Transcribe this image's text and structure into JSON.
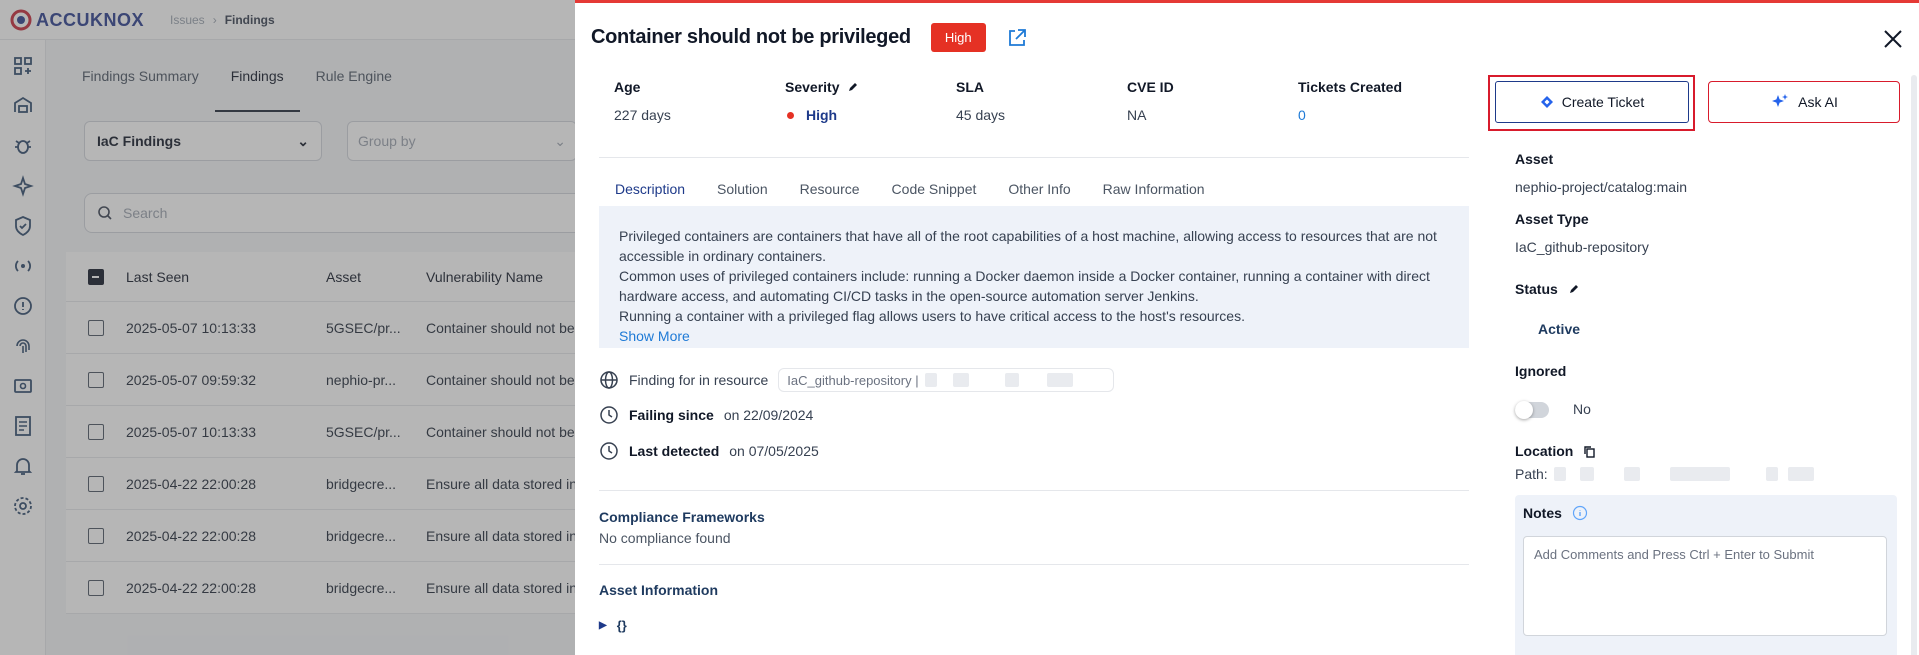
{
  "app": {
    "logo": "ACCUKNOX",
    "breadcrumb": [
      "Issues",
      "Findings"
    ]
  },
  "background": {
    "tabs": [
      "Findings Summary",
      "Findings",
      "Rule Engine"
    ],
    "active_tab": "Findings",
    "filter_select": "IaC Findings",
    "group_by_placeholder": "Group by",
    "search_placeholder": "Search",
    "table": {
      "columns": [
        "Last Seen",
        "Asset",
        "Vulnerability Name"
      ],
      "rows": [
        {
          "last_seen": "2025-05-07 10:13:33",
          "asset": "5GSEC/pr...",
          "vulnerability": "Container should not be"
        },
        {
          "last_seen": "2025-05-07 09:59:32",
          "asset": "nephio-pr...",
          "vulnerability": "Container should not be"
        },
        {
          "last_seen": "2025-05-07 10:13:33",
          "asset": "5GSEC/pr...",
          "vulnerability": "Container should not be"
        },
        {
          "last_seen": "2025-04-22 22:00:28",
          "asset": "bridgecre...",
          "vulnerability": "Ensure all data stored in"
        },
        {
          "last_seen": "2025-04-22 22:00:28",
          "asset": "bridgecre...",
          "vulnerability": "Ensure all data stored in"
        },
        {
          "last_seen": "2025-04-22 22:00:28",
          "asset": "bridgecre...",
          "vulnerability": "Ensure all data stored in"
        }
      ]
    }
  },
  "drawer": {
    "title": "Container should not be privileged",
    "severity_badge": "High",
    "meta": {
      "age_label": "Age",
      "age_value": "227 days",
      "severity_label": "Severity",
      "severity_value": "High",
      "sla_label": "SLA",
      "sla_value": "45 days",
      "cve_label": "CVE ID",
      "cve_value": "NA",
      "tickets_label": "Tickets Created",
      "tickets_value": "0"
    },
    "tabs": [
      "Description",
      "Solution",
      "Resource",
      "Code Snippet",
      "Other Info",
      "Raw Information"
    ],
    "active_tab": "Description",
    "description": {
      "line1": "Privileged containers are containers that have all of the root capabilities of a host machine, allowing access to resources that are not",
      "line2": "accessible in ordinary containers.",
      "line3": "Common uses of privileged containers include: running a Docker daemon inside a Docker container, running a container with direct",
      "line4": "hardware access, and automating CI/CD tasks in the open-source automation server Jenkins.",
      "line5": "Running a container with a privileged flag allows users to have critical access to the host's resources.",
      "show_more": "Show More"
    },
    "finding_label": "Finding for in resource",
    "finding_resource": "IaC_github-repository |",
    "failing_label": "Failing since",
    "failing_value": "on 22/09/2024",
    "detected_label": "Last detected",
    "detected_value": "on 07/05/2025",
    "compliance_title": "Compliance Frameworks",
    "compliance_value": "No compliance found",
    "asset_info_title": "Asset Information",
    "asset_info_tree": "{}",
    "right": {
      "create_ticket": "Create Ticket",
      "ask_ai": "Ask AI",
      "asset_label": "Asset",
      "asset_value": "nephio-project/catalog:main",
      "asset_type_label": "Asset Type",
      "asset_type_value": "IaC_github-repository",
      "status_label": "Status",
      "status_value": "Active",
      "ignored_label": "Ignored",
      "ignored_value": "No",
      "location_label": "Location",
      "path_label": "Path:",
      "notes_label": "Notes",
      "notes_placeholder": "Add Comments and Press Ctrl + Enter to Submit"
    }
  },
  "colors": {
    "accent_red": "#e53124",
    "brand_navy": "#1e3a8a",
    "link_blue": "#1e7ad6"
  }
}
